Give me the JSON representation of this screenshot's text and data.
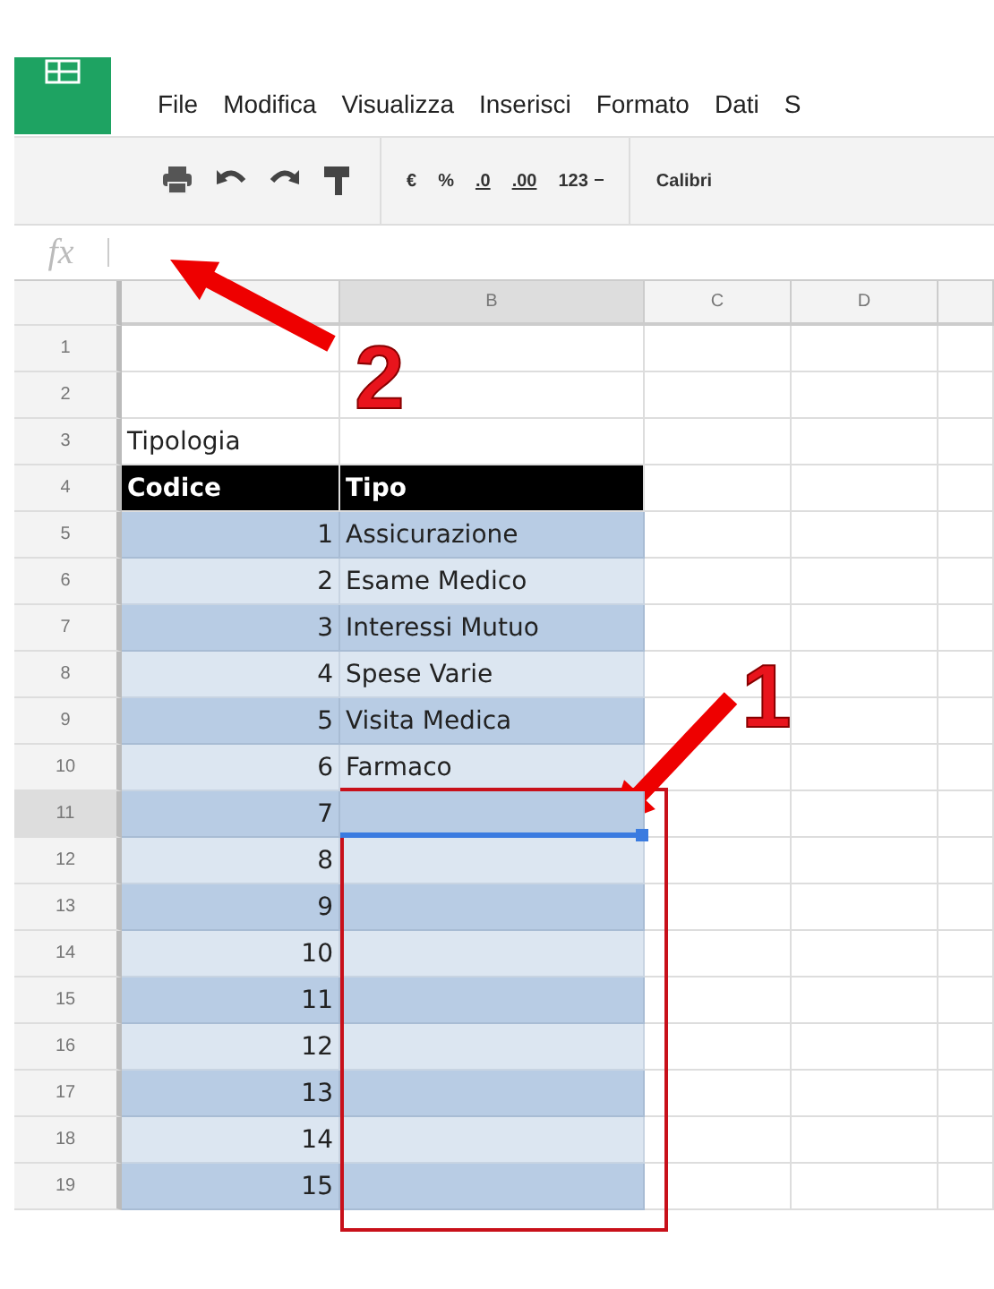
{
  "menu": {
    "items": [
      "File",
      "Modifica",
      "Visualizza",
      "Inserisci",
      "Formato",
      "Dati",
      "S"
    ]
  },
  "toolbar": {
    "groups": [
      [
        {
          "kind": "print"
        },
        {
          "kind": "undo"
        },
        {
          "kind": "redo"
        },
        {
          "kind": "paint"
        }
      ],
      [
        {
          "kind": "text",
          "label": "€"
        },
        {
          "kind": "text",
          "label": "%"
        },
        {
          "kind": "decimal",
          "label": ".0"
        },
        {
          "kind": "decimal",
          "label": ".00"
        },
        {
          "kind": "dropdown",
          "label": "123"
        }
      ],
      [
        {
          "kind": "text",
          "label": "Calibri"
        }
      ]
    ]
  },
  "formula_bar": {
    "label": "fx"
  },
  "columns": [
    {
      "selected": false
    },
    {
      "label": "B",
      "selected": true
    },
    {
      "label": "C",
      "selected": false
    },
    {
      "label": "D",
      "selected": false
    },
    {
      "selected": false
    }
  ],
  "rows": [
    {
      "number": "1",
      "kind": "blank",
      "selected": false
    },
    {
      "number": "2",
      "kind": "blank",
      "selected": false
    },
    {
      "number": "3",
      "kind": "title",
      "selected": false,
      "a": "Tipologia"
    },
    {
      "number": "4",
      "kind": "header",
      "selected": false,
      "a": "Codice",
      "b": "Tipo"
    },
    {
      "number": "5",
      "kind": "dark",
      "selected": false,
      "a": "1",
      "b": "Assicurazione"
    },
    {
      "number": "6",
      "kind": "light",
      "selected": false,
      "a": "2",
      "b": "Esame Medico"
    },
    {
      "number": "7",
      "kind": "dark",
      "selected": false,
      "a": "3",
      "b": "Interessi Mutuo"
    },
    {
      "number": "8",
      "kind": "light",
      "selected": false,
      "a": "4",
      "b": "Spese Varie"
    },
    {
      "number": "9",
      "kind": "dark",
      "selected": false,
      "a": "5",
      "b": "Visita Medica"
    },
    {
      "number": "10",
      "kind": "light",
      "selected": false,
      "a": "6",
      "b": "Farmaco"
    },
    {
      "number": "11",
      "kind": "dark",
      "selected": true,
      "a": "7"
    },
    {
      "number": "12",
      "kind": "light",
      "selected": false,
      "a": "8"
    },
    {
      "number": "13",
      "kind": "dark",
      "selected": false,
      "a": "9"
    },
    {
      "number": "14",
      "kind": "light",
      "selected": false,
      "a": "10"
    },
    {
      "number": "15",
      "kind": "dark",
      "selected": false,
      "a": "11"
    },
    {
      "number": "16",
      "kind": "light",
      "selected": false,
      "a": "12"
    },
    {
      "number": "17",
      "kind": "dark",
      "selected": false,
      "a": "13"
    },
    {
      "number": "18",
      "kind": "light",
      "selected": false,
      "a": "14"
    },
    {
      "number": "19",
      "kind": "dark",
      "selected": false,
      "a": "15"
    }
  ],
  "callouts": [
    {
      "label": "2"
    },
    {
      "label": "1"
    }
  ]
}
